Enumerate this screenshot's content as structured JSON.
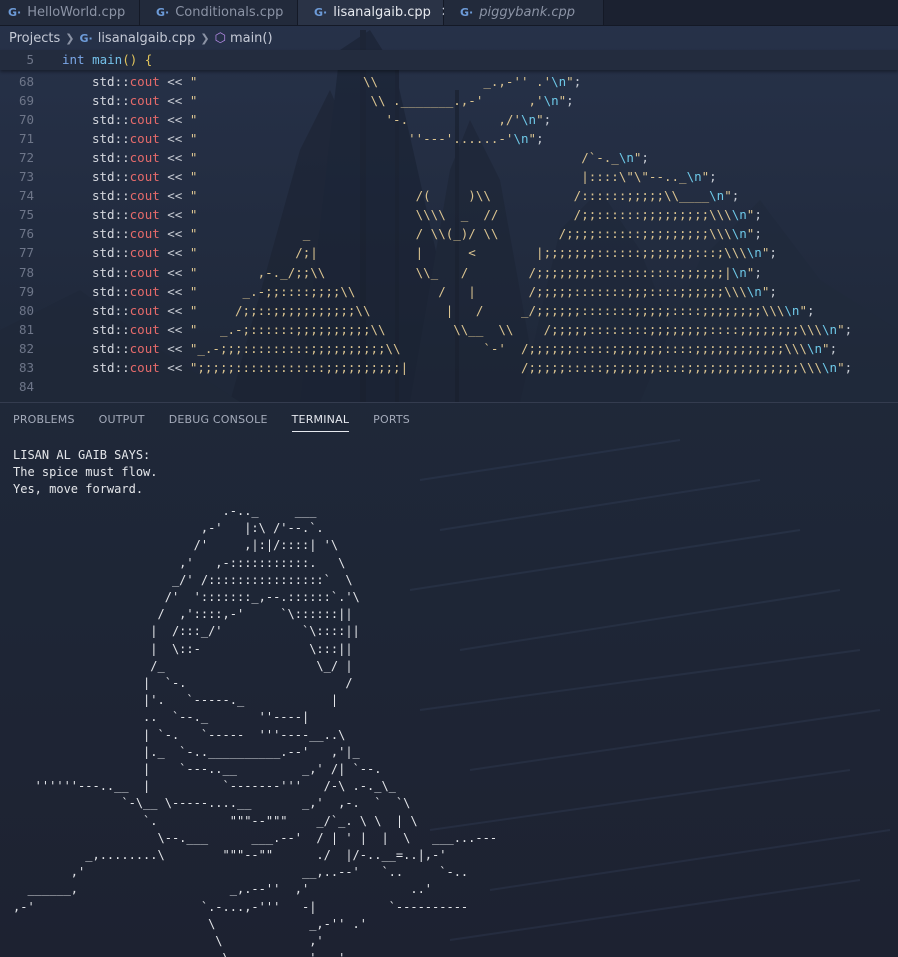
{
  "tabs": [
    {
      "label": "HelloWorld.cpp",
      "active": false,
      "italic": false
    },
    {
      "label": "Conditionals.cpp",
      "active": false,
      "italic": false
    },
    {
      "label": "lisanalgaib.cpp",
      "active": true,
      "italic": false
    },
    {
      "label": "piggybank.cpp",
      "active": false,
      "italic": true
    }
  ],
  "breadcrumb": {
    "root": "Projects",
    "file": "lisanalgaib.cpp",
    "symbol": "main()"
  },
  "editor": {
    "sticky": {
      "line": "5",
      "kw": "int",
      "fn": "main",
      "paren": "()",
      "brace": " {"
    },
    "std_prefix": "std::",
    "cout": "cout",
    "op": " << ",
    "end": ";",
    "lines": [
      {
        "n": "68",
        "str": "\"                      \\\\              _.,-'' .'",
        "esc": "\\n",
        "tail": "\""
      },
      {
        "n": "69",
        "str": "\"                       \\\\ ._______.,-'      ,'",
        "esc": "\\n",
        "tail": "\""
      },
      {
        "n": "70",
        "str": "\"                         '-.            ,/'",
        "esc": "\\n",
        "tail": "\""
      },
      {
        "n": "71",
        "str": "\"                            ''---'......-'",
        "esc": "\\n",
        "tail": "\""
      },
      {
        "n": "72",
        "str": "\"                                                   /`-._",
        "esc": "\\n",
        "tail": "\""
      },
      {
        "n": "73",
        "str": "\"                                                   |::::\\\"\\\"--.._",
        "esc": "\\n",
        "tail": "\""
      },
      {
        "n": "74",
        "str": "\"                             /(     )\\\\           /::::::;;;;;\\\\____",
        "esc": "\\n",
        "tail": "\""
      },
      {
        "n": "75",
        "str": "\"                             \\\\\\\\  _  //          /;;::::::;;;;;;;;;\\\\\\",
        "esc": "\\n",
        "tail": "\""
      },
      {
        "n": "76",
        "str": "\"              _              / \\\\(_)/ \\\\        /;;;;::::::;;;;;;;;;\\\\\\",
        "esc": "\\n",
        "tail": "\""
      },
      {
        "n": "77",
        "str": "\"             /;|             |      <        |;;;;;;;::::::;;;;;;;:::;\\\\\\",
        "esc": "\\n",
        "tail": "\""
      },
      {
        "n": "78",
        "str": "\"        ,-._/;;\\\\            \\\\_   /        /;;;;;;;;:::::::::::;;;;;;|",
        "esc": "\\n",
        "tail": "\""
      },
      {
        "n": "79",
        "str": "\"      _.-;;::::;;;;\\\\           /   |       /;;;;;:::::::;;;::::;;;;;;\\\\\\",
        "esc": "\\n",
        "tail": "\""
      },
      {
        "n": "80",
        "str": "\"     /;;::;;;;;;;;;;;\\\\          |   /     _/;;;;;;:::::::;;;;;::::;;;;;;;;\\\\\\",
        "esc": "\\n",
        "tail": "\""
      },
      {
        "n": "81",
        "str": "\"   _.-;::::::;;;;;;;;;;\\\\         \\\\__  \\\\    /;;;;;::::::::;;;;;;;;::::;;;;;;;;\\\\\\",
        "esc": "\\n",
        "tail": "\""
      },
      {
        "n": "82",
        "str": "\"_.-;;;:::::::::;;;;;;;;;;\\\\           `-'  /;;;;;;:::::;;;;;;;::::;;;;;;;;;;;;\\\\\\",
        "esc": "\\n",
        "tail": "\""
      },
      {
        "n": "83",
        "str": "\";;;;;::::::::::::;;;;;;;;;;|               /;;;;;:::::;;;;;;;::::;;;;;;;;;;;;;;;\\\\\\",
        "esc": "\\n",
        "tail": "\""
      },
      {
        "n": "84",
        "str": "",
        "esc": "",
        "tail": "",
        "empty": true
      }
    ]
  },
  "panel": {
    "tabs": [
      "PROBLEMS",
      "OUTPUT",
      "DEBUG CONSOLE",
      "TERMINAL",
      "PORTS"
    ],
    "active": "TERMINAL"
  },
  "terminal": {
    "lines": [
      "LISAN AL GAIB SAYS:",
      "The spice must flow.",
      "Yes, move forward."
    ],
    "art": "                             .-.._     ___\n                          ,-'   |:\\ /'--.`.\n                         /'     ,|:|/::::| '\\\n                       ,'   ,-:::::::::::.   \\\n                      _/' /::::::::::::::::`  \\\n                     /'  ':::::::_,--.::::::`.'\\\n                    /  ,'::::,-'     `\\::::::||\n                   |  /:::_/'           `\\::::||\n                   |  \\::-               \\:::||\n                   /_                     \\_/ |\n                  |  `-.                      /\n                  |'.   `-----._            |\n                  ..  `--._       ''----|\n                  | `-.   `-----  '''----__..\\\n                  |._  `-..__________.--'   ,'|_\n                  |    `---..__         _,' /| `--.\n   ''''''---..__  |          `-------'''   /-\\ .-._\\_\n               `-\\__ \\-----....__       _,'  ,-.  `  `\\\n                  `.          \"\"\"--\"\"\"    _/`_. \\ \\  | \\\n                    \\--.___      ___.--'  / | ' |  |  \\   ___...---\n          _,........\\        \"\"\"--\"\"      ./  |/-..__=..|,-'\n        ,'                              __,..--'   `..     `-..\n  ______,                     _,.--''  ,'              ..'\n,-'                       `.-...,-'''   -|          `----------\n                           \\             _,-'' .'\n                            \\            ,'\n                             \\ .-______.-'  ,'\n                              `-.          ,/'\n                                 ''---'......-'"
  }
}
